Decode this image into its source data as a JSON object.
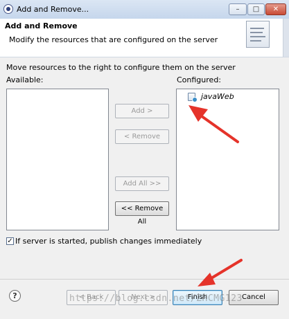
{
  "window": {
    "title": "Add and Remove...",
    "controls": {
      "minimize": "–",
      "maximize": "□",
      "close": "✕"
    }
  },
  "header": {
    "title": "Add and Remove",
    "description": "Modify the resources that are configured on the server"
  },
  "main": {
    "instruction": "Move resources to the right to configure them on the server",
    "available_label": "Available:",
    "configured_label": "Configured:",
    "available_items": [],
    "configured_items": [
      {
        "label": "javaWeb",
        "icon": "web-project-icon"
      }
    ],
    "buttons": {
      "add": "Add >",
      "remove": "< Remove",
      "add_all": "Add All >>",
      "remove_all": "<< Remove All"
    },
    "publish_checkbox": {
      "label": "If server is started, publish changes immediately",
      "checked": true
    }
  },
  "footer": {
    "help": "?",
    "back": "< Back",
    "next": "Next >",
    "finish": "Finish",
    "cancel": "Cancel"
  },
  "watermark": "https://blog.csdn.net/ZHCMG123",
  "colors": {
    "annotation_arrow": "#e5332a",
    "accent": "#3c7fb1"
  }
}
